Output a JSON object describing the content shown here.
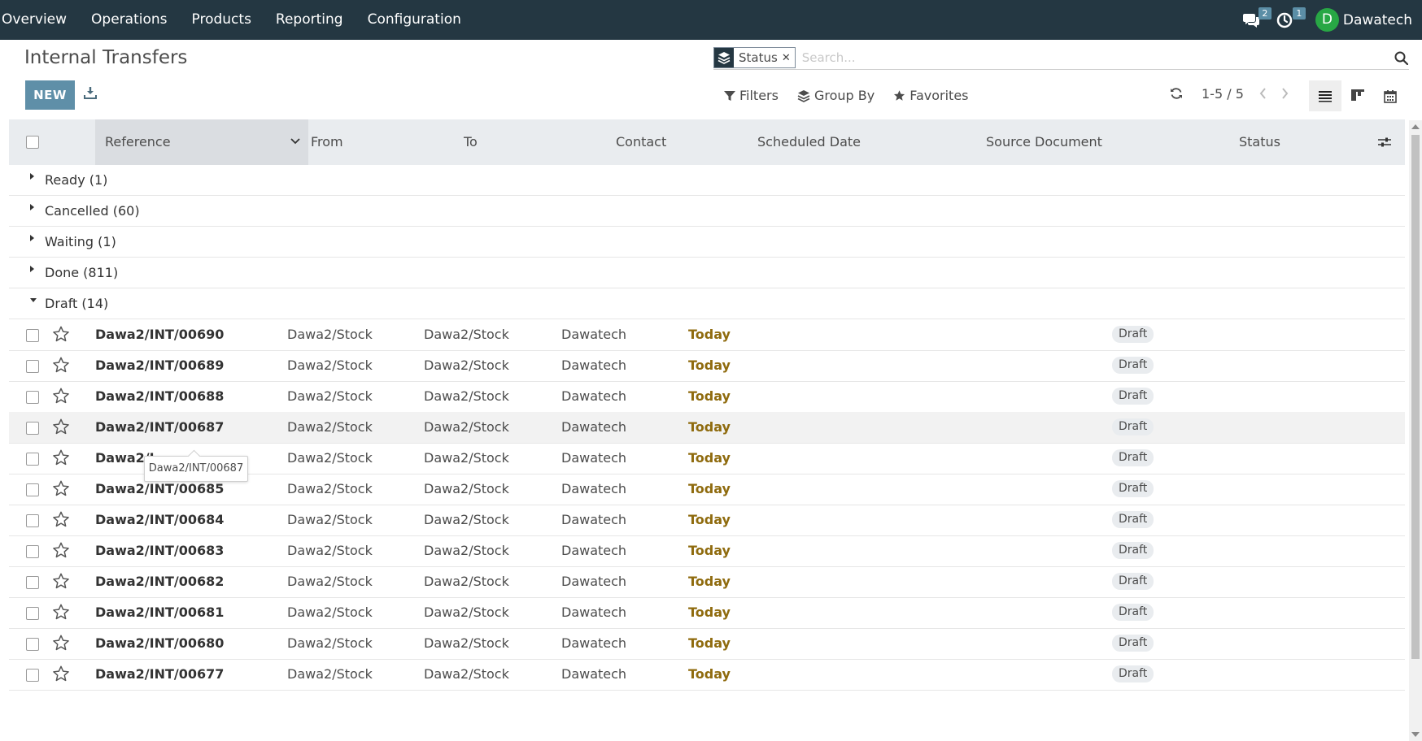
{
  "navbar": {
    "menu": [
      "Overview",
      "Operations",
      "Products",
      "Reporting",
      "Configuration"
    ],
    "messages_count": "2",
    "activities_count": "1",
    "user_initial": "D",
    "user_name": "Dawatech"
  },
  "control_panel": {
    "title": "Internal Transfers",
    "new_label": "NEW",
    "search_facet": "Status",
    "search_placeholder": "Search...",
    "filters_label": "Filters",
    "group_by_label": "Group By",
    "favorites_label": "Favorites",
    "pager": "1-5 / 5"
  },
  "list": {
    "columns": [
      "Reference",
      "From",
      "To",
      "Contact",
      "Scheduled Date",
      "Source Document",
      "Status"
    ],
    "groups": [
      {
        "label": "Ready (1)",
        "expanded": false
      },
      {
        "label": "Cancelled (60)",
        "expanded": false
      },
      {
        "label": "Waiting (1)",
        "expanded": false
      },
      {
        "label": "Done (811)",
        "expanded": false
      },
      {
        "label": "Draft (14)",
        "expanded": true
      }
    ],
    "rows": [
      {
        "reference": "Dawa2/INT/00690",
        "from": "Dawa2/Stock",
        "to": "Dawa2/Stock",
        "contact": "Dawatech",
        "scheduled": "Today",
        "status": "Draft"
      },
      {
        "reference": "Dawa2/INT/00689",
        "from": "Dawa2/Stock",
        "to": "Dawa2/Stock",
        "contact": "Dawatech",
        "scheduled": "Today",
        "status": "Draft"
      },
      {
        "reference": "Dawa2/INT/00688",
        "from": "Dawa2/Stock",
        "to": "Dawa2/Stock",
        "contact": "Dawatech",
        "scheduled": "Today",
        "status": "Draft"
      },
      {
        "reference": "Dawa2/INT/00687",
        "from": "Dawa2/Stock",
        "to": "Dawa2/Stock",
        "contact": "Dawatech",
        "scheduled": "Today",
        "status": "Draft"
      },
      {
        "reference": "Dawa2/I",
        "from": "Dawa2/Stock",
        "to": "Dawa2/Stock",
        "contact": "Dawatech",
        "scheduled": "Today",
        "status": "Draft"
      },
      {
        "reference": "Dawa2/INT/00685",
        "from": "Dawa2/Stock",
        "to": "Dawa2/Stock",
        "contact": "Dawatech",
        "scheduled": "Today",
        "status": "Draft"
      },
      {
        "reference": "Dawa2/INT/00684",
        "from": "Dawa2/Stock",
        "to": "Dawa2/Stock",
        "contact": "Dawatech",
        "scheduled": "Today",
        "status": "Draft"
      },
      {
        "reference": "Dawa2/INT/00683",
        "from": "Dawa2/Stock",
        "to": "Dawa2/Stock",
        "contact": "Dawatech",
        "scheduled": "Today",
        "status": "Draft"
      },
      {
        "reference": "Dawa2/INT/00682",
        "from": "Dawa2/Stock",
        "to": "Dawa2/Stock",
        "contact": "Dawatech",
        "scheduled": "Today",
        "status": "Draft"
      },
      {
        "reference": "Dawa2/INT/00681",
        "from": "Dawa2/Stock",
        "to": "Dawa2/Stock",
        "contact": "Dawatech",
        "scheduled": "Today",
        "status": "Draft"
      },
      {
        "reference": "Dawa2/INT/00680",
        "from": "Dawa2/Stock",
        "to": "Dawa2/Stock",
        "contact": "Dawatech",
        "scheduled": "Today",
        "status": "Draft"
      },
      {
        "reference": "Dawa2/INT/00677",
        "from": "Dawa2/Stock",
        "to": "Dawa2/Stock",
        "contact": "Dawatech",
        "scheduled": "Today",
        "status": "Draft"
      }
    ],
    "tooltip": "Dawa2/INT/00687"
  },
  "colors": {
    "navbar_bg": "#243742",
    "primary_button": "#5f8fa8",
    "date_today": "#8f6b0e",
    "avatar_bg": "#28a745"
  },
  "icons": [
    "comments-icon",
    "clock-icon",
    "layers-icon",
    "search-icon",
    "download-icon",
    "filter-icon",
    "group-by-icon",
    "star-icon",
    "refresh-icon",
    "chevron-left-icon",
    "chevron-right-icon",
    "list-view-icon",
    "kanban-view-icon",
    "calendar-view-icon",
    "column-settings-icon"
  ]
}
